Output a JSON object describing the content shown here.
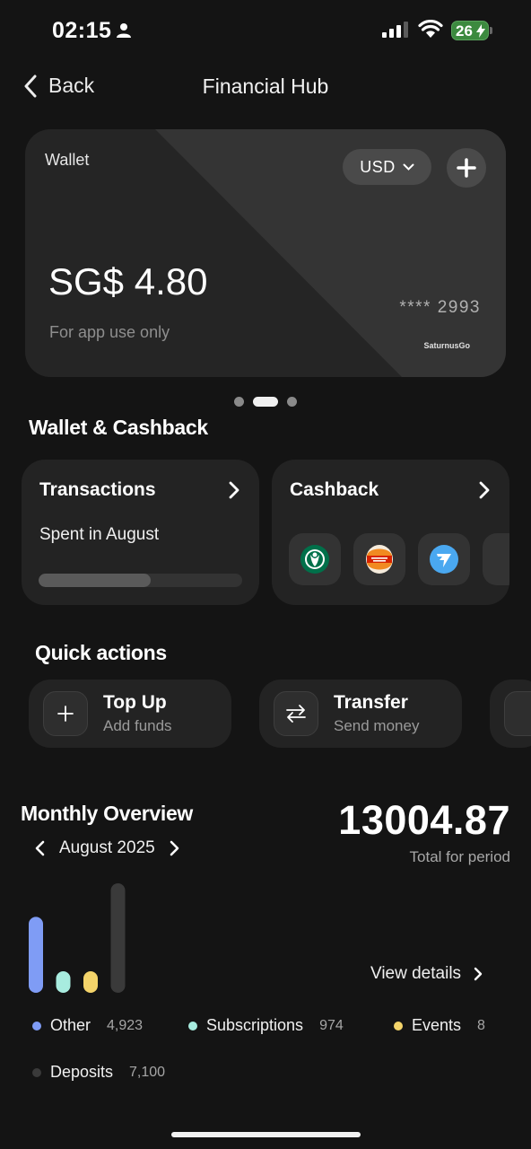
{
  "status_bar": {
    "time": "02:15",
    "battery": "26"
  },
  "nav": {
    "back_label": "Back",
    "title": "Financial Hub"
  },
  "wallet_card": {
    "label": "Wallet",
    "currency": "USD",
    "balance": "SG$ 4.80",
    "note": "For app use only",
    "card_number": "**** 2993",
    "brand": "SaturnusGo"
  },
  "carousel": {
    "pages": 3,
    "active": 2
  },
  "wallet_cashback": {
    "title": "Wallet & Cashback",
    "transactions": {
      "title": "Transactions",
      "subtitle": "Spent in August",
      "progress": 0.55
    },
    "cashback": {
      "title": "Cashback",
      "merchants": [
        "starbucks",
        "burger-king",
        "wise"
      ]
    }
  },
  "quick_actions": {
    "title": "Quick actions",
    "items": [
      {
        "title": "Top Up",
        "subtitle": "Add funds",
        "icon": "plus-icon"
      },
      {
        "title": "Transfer",
        "subtitle": "Send money",
        "icon": "transfer-arrows-icon"
      }
    ]
  },
  "monthly_overview": {
    "title": "Monthly Overview",
    "month": "August 2025",
    "total": "13004.87",
    "total_label": "Total for period",
    "view_details": "View details",
    "legend": [
      {
        "name": "Other",
        "value": "4,923",
        "color": "#7f9cf5"
      },
      {
        "name": "Subscriptions",
        "value": "974",
        "color": "#a8ecdf"
      },
      {
        "name": "Events",
        "value": "8",
        "color": "#f4d46a"
      },
      {
        "name": "Deposits",
        "value": "7,100",
        "color": "#3a3a3a"
      }
    ]
  },
  "chart_data": {
    "type": "bar",
    "categories": [
      "Other",
      "Subscriptions",
      "Events",
      "Deposits"
    ],
    "values": [
      4923,
      974,
      8,
      7100
    ],
    "colors": [
      "#7f9cf5",
      "#a8ecdf",
      "#f4d46a",
      "#3a3a3a"
    ]
  }
}
